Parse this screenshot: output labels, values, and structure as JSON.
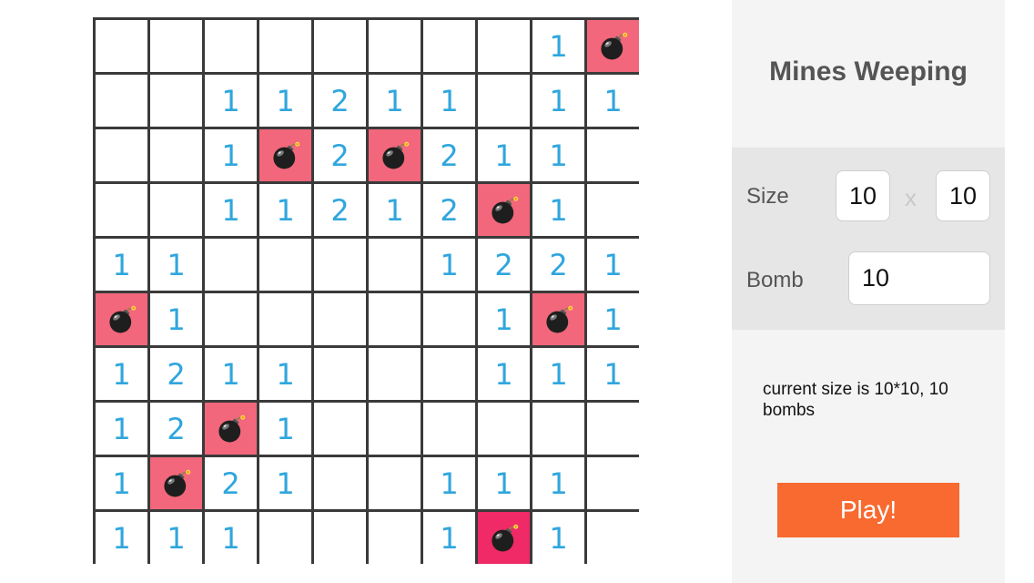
{
  "app_title": "Mines Weeping",
  "board": {
    "rows": 10,
    "cols": 10,
    "cells": [
      [
        "",
        "",
        "",
        "",
        "",
        "",
        "",
        "",
        "1",
        "B"
      ],
      [
        "",
        "",
        "1",
        "1",
        "2",
        "1",
        "1",
        "",
        "1",
        "1"
      ],
      [
        "",
        "",
        "1",
        "B",
        "2",
        "B",
        "2",
        "1",
        "1",
        ""
      ],
      [
        "",
        "",
        "1",
        "1",
        "2",
        "1",
        "2",
        "B",
        "1",
        ""
      ],
      [
        "1",
        "1",
        "",
        "",
        "",
        "",
        "1",
        "2",
        "2",
        "1"
      ],
      [
        "B",
        "1",
        "",
        "",
        "",
        "",
        "",
        "1",
        "B",
        "1"
      ],
      [
        "1",
        "2",
        "1",
        "1",
        "",
        "",
        "",
        "1",
        "1",
        "1"
      ],
      [
        "1",
        "2",
        "B",
        "1",
        "",
        "",
        "",
        "",
        "",
        ""
      ],
      [
        "1",
        "B",
        "2",
        "1",
        "",
        "",
        "1",
        "1",
        "1",
        ""
      ],
      [
        "1",
        "1",
        "1",
        "",
        "",
        "",
        "1",
        "X",
        "1",
        ""
      ]
    ],
    "colors": {
      "number": "#2fa6dd",
      "bomb_bg": "#f2677b",
      "exploded_bg": "#ef2a66",
      "grid": "#3a3a3a"
    }
  },
  "settings": {
    "size_label": "Size",
    "size_rows_value": "10",
    "size_separator": "x",
    "size_cols_value": "10",
    "bomb_label": "Bomb",
    "bomb_value": "10"
  },
  "status_text": "current size is 10*10, 10 bombs",
  "play_label": "Play!",
  "accent_color": "#f86a2f",
  "icons": {
    "bomb": "bomb-icon"
  }
}
